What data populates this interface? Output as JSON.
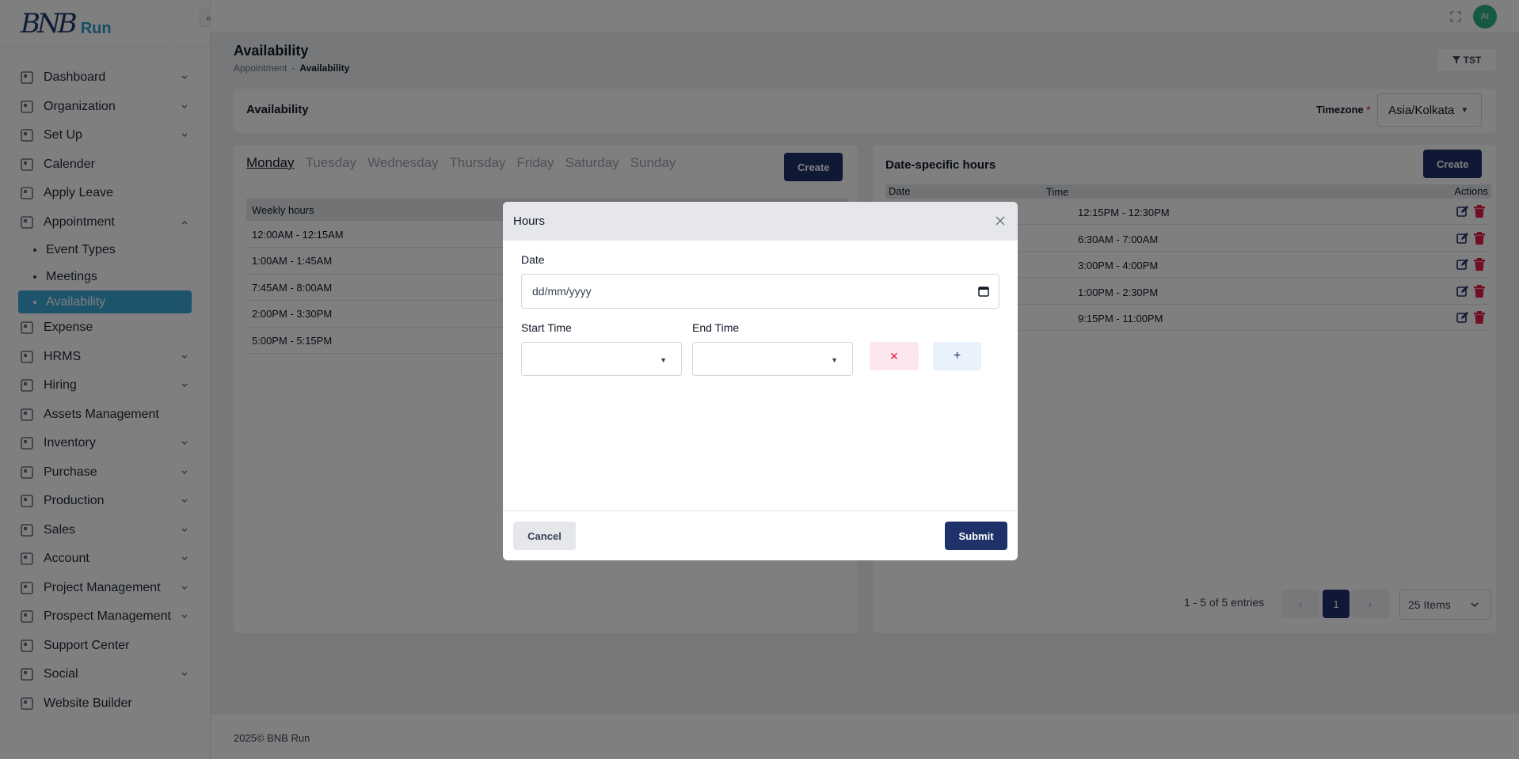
{
  "brand": {
    "mark": "BNB",
    "word": "Run"
  },
  "sidebar": {
    "items": [
      {
        "label": "Dashboard",
        "icon": "dashboard-icon",
        "expandable": true
      },
      {
        "label": "Organization",
        "icon": "document-icon",
        "expandable": true
      },
      {
        "label": "Set Up",
        "icon": "setup-document-icon",
        "expandable": true
      },
      {
        "label": "Calender",
        "icon": "hourglass-icon",
        "expandable": false
      },
      {
        "label": "Apply Leave",
        "icon": "lifebuoy-icon",
        "expandable": false
      },
      {
        "label": "Appointment",
        "icon": "calendar-check-icon",
        "expandable": true,
        "expanded": true
      }
    ],
    "appointment_sub": [
      "Event Types",
      "Meetings",
      "Availability"
    ],
    "items_after": [
      {
        "label": "Expense",
        "icon": "money-icon",
        "expandable": false
      },
      {
        "label": "HRMS",
        "icon": "people-grid-icon",
        "expandable": true
      },
      {
        "label": "Hiring",
        "icon": "hiring-icon",
        "expandable": true
      },
      {
        "label": "Assets Management",
        "icon": "assets-icon",
        "expandable": false
      },
      {
        "label": "Inventory",
        "icon": "inventory-icon",
        "expandable": true
      },
      {
        "label": "Purchase",
        "icon": "cart-icon",
        "expandable": true
      },
      {
        "label": "Production",
        "icon": "factory-icon",
        "expandable": true
      },
      {
        "label": "Sales",
        "icon": "scale-icon",
        "expandable": true
      },
      {
        "label": "Account",
        "icon": "bank-icon",
        "expandable": true
      },
      {
        "label": "Project Management",
        "icon": "project-icon",
        "expandable": true
      },
      {
        "label": "Prospect Management",
        "icon": "prospect-icon",
        "expandable": true
      },
      {
        "label": "Support Center",
        "icon": "support-icon",
        "expandable": false
      },
      {
        "label": "Social",
        "icon": "social-icon",
        "expandable": true
      },
      {
        "label": "Website Builder",
        "icon": "website-icon",
        "expandable": false
      }
    ]
  },
  "topbar": {
    "avatar": "AI"
  },
  "page": {
    "title": "Availability",
    "breadcrumb": [
      "Appointment",
      "-",
      "Availability"
    ],
    "tz_button": "TST"
  },
  "availability_card": {
    "title": "Availability",
    "timezone_label": "Timezone",
    "timezone_required": "*",
    "timezone_value": "Asia/Kolkata"
  },
  "weekly": {
    "days": [
      "Monday",
      "Tuesday",
      "Wednesday",
      "Thursday",
      "Friday",
      "Saturday",
      "Sunday"
    ],
    "active_day": "Monday",
    "create_label": "Create",
    "header": "Weekly hours",
    "rows": [
      "12:00AM - 12:15AM",
      "1:00AM - 1:45AM",
      "7:45AM - 8:00AM",
      "2:00PM - 3:30PM",
      "5:00PM - 5:15PM"
    ]
  },
  "date_specific": {
    "title": "Date-specific hours",
    "create_label": "Create",
    "columns": [
      "Date",
      "Time",
      "Actions"
    ],
    "rows": [
      "12:15PM - 12:30PM",
      "6:30AM - 7:00AM",
      "3:00PM - 4:00PM",
      "1:00PM - 2:30PM",
      "9:15PM - 11:00PM"
    ],
    "entries": "1 - 5 of 5 entries",
    "page": "1",
    "prev": "‹",
    "next": "›",
    "items_per_page": "25 Items"
  },
  "footer": "2025© BNB Run",
  "modal": {
    "title": "Hours",
    "date_label": "Date",
    "date_placeholder": "dd/mm/yyyy",
    "start_label": "Start Time",
    "end_label": "End Time",
    "cancel_label": "Cancel",
    "submit_label": "Submit"
  },
  "colors": {
    "primary": "#1e3168",
    "accent": "#3ba8d8",
    "danger": "#e11d48"
  }
}
